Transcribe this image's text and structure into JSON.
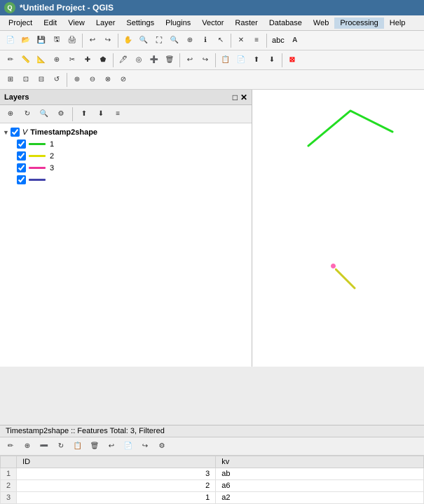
{
  "titlebar": {
    "logo_text": "Q",
    "title": "*Untitled Project - QGIS"
  },
  "menubar": {
    "items": [
      "Project",
      "Edit",
      "View",
      "Layer",
      "Settings",
      "Plugins",
      "Vector",
      "Raster",
      "Database",
      "Web",
      "Processing",
      "Help"
    ]
  },
  "toolbars": {
    "toolbar1": {
      "buttons": [
        "📁",
        "📂",
        "💾",
        "📷",
        "🖨",
        "✂",
        "📋",
        "↩",
        "↪"
      ]
    }
  },
  "layers_panel": {
    "title": "Layers",
    "maximize_label": "□",
    "close_label": "✕",
    "toolbar_buttons": [
      "⊕",
      "↻",
      "🔍",
      "⚙",
      "⬇",
      "≡",
      "▤"
    ],
    "group": {
      "name": "Timestamp2shape",
      "items": [
        {
          "id": 1,
          "label": "1",
          "color": "#22cc22",
          "checked": true
        },
        {
          "id": 2,
          "label": "2",
          "color": "#dddd00",
          "checked": true
        },
        {
          "id": 3,
          "label": "3",
          "color": "#ee3399",
          "checked": true
        },
        {
          "id": 4,
          "label": "",
          "color": "#4444aa",
          "checked": true
        }
      ]
    }
  },
  "map": {
    "bg": "white"
  },
  "attr_table": {
    "title": "Timestamp2shape :: Features Total: 3, Filtered",
    "toolbar_buttons": [
      "✏",
      "⊕",
      "➖",
      "↻",
      "📋",
      "🗑",
      "↩",
      "📄",
      "↪",
      "⚙"
    ],
    "columns": [
      "ID",
      "kv"
    ],
    "rows": [
      {
        "row_num": "1",
        "id": "3",
        "kv": "ab"
      },
      {
        "row_num": "2",
        "id": "2",
        "kv": "a6"
      },
      {
        "row_num": "3",
        "id": "1",
        "kv": "a2"
      }
    ]
  }
}
